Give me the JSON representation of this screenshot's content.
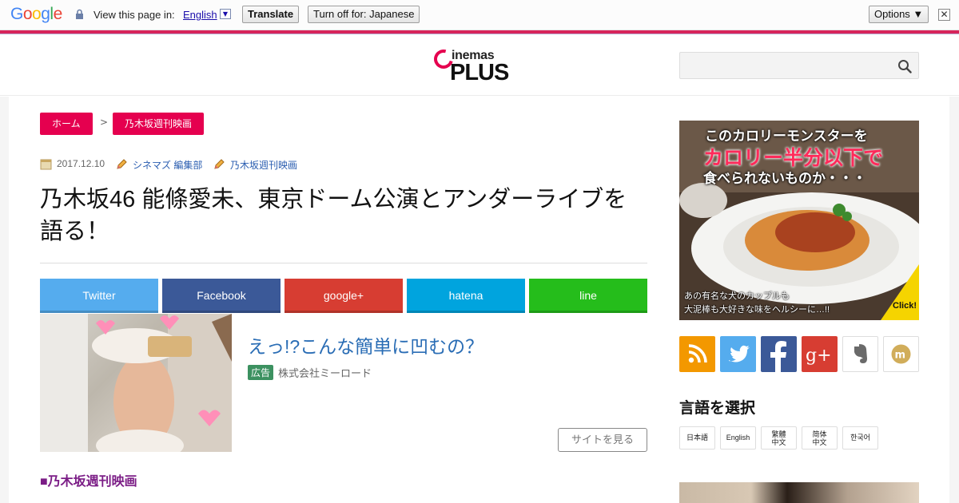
{
  "translate_bar": {
    "logo": [
      "G",
      "o",
      "o",
      "g",
      "l",
      "e"
    ],
    "logo_colors": [
      "#4285f4",
      "#ea4335",
      "#fbbc05",
      "#4285f4",
      "#34a853",
      "#ea4335"
    ],
    "view_text": "View this page in:",
    "language": "English",
    "dropdown_glyph": "▼",
    "translate_label": "Translate",
    "turn_off_label": "Turn off for: Japanese",
    "options_label": "Options ▼",
    "close_glyph": "✕"
  },
  "header": {
    "logo_top": "inemas",
    "logo_bottom": "PLUS",
    "search_placeholder": ""
  },
  "breadcrumb": {
    "home": "ホーム",
    "separator": ">",
    "category": "乃木坂週刊映画"
  },
  "meta": {
    "date": "2017.12.10",
    "author": "シネマズ 編集部",
    "category": "乃木坂週刊映画"
  },
  "article": {
    "title": "乃木坂46 能條愛未、東京ドーム公演とアンダーライブを語る！",
    "section_tag": "■乃木坂週刊映画"
  },
  "share": [
    {
      "label": "Twitter",
      "color": "#55acee"
    },
    {
      "label": "Facebook",
      "color": "#3b5998"
    },
    {
      "label": "google+",
      "color": "#d73d32"
    },
    {
      "label": "hatena",
      "color": "#00a4de"
    },
    {
      "label": "line",
      "color": "#25bd1b"
    }
  ],
  "ad": {
    "title": "えっ!?こんな簡単に凹むの？",
    "badge": "広告",
    "company": "株式会社ミーロード",
    "button": "サイトを見る"
  },
  "banner": {
    "line1": "このカロリーモンスターを",
    "line2": "カロリー半分以下で",
    "line3": "食べられないものか・・・",
    "bottom1": "あの有名な犬のカップルも",
    "bottom2": "大泥棒も大好きな味をヘルシーに…!!",
    "click": "Click!"
  },
  "sns_icons": [
    {
      "name": "rss-icon",
      "color": "#f39800"
    },
    {
      "name": "twitter-icon",
      "color": "#55acee"
    },
    {
      "name": "facebook-icon",
      "color": "#3b5998"
    },
    {
      "name": "google-plus-icon",
      "color": "#d73d32"
    },
    {
      "name": "evernote-icon",
      "color": "#ffffff"
    },
    {
      "name": "mixi-icon",
      "color": "#ffffff"
    }
  ],
  "language_section": {
    "heading": "言語を選択",
    "buttons": [
      "日本語",
      "English",
      "繁體中文",
      "简体中文",
      "한국어"
    ]
  }
}
